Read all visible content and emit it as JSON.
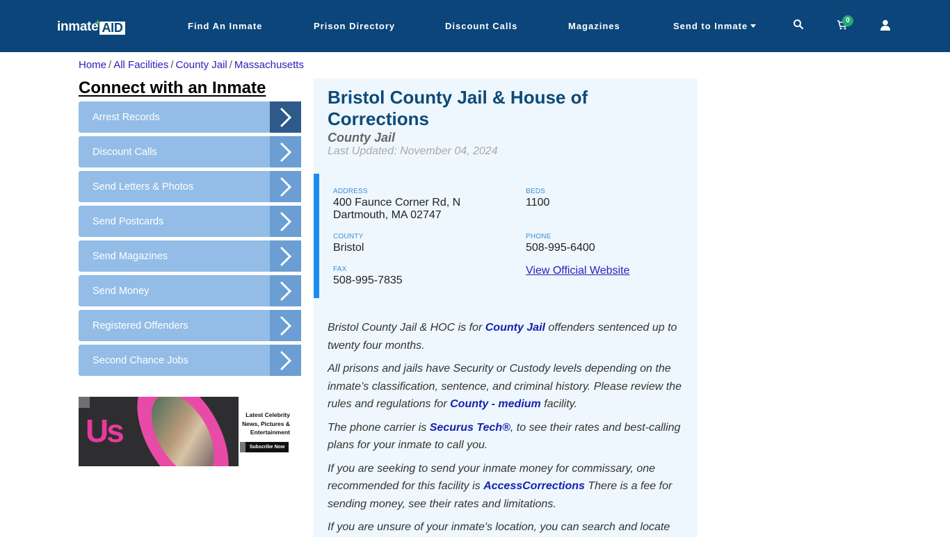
{
  "nav": {
    "logo_text": "inmate",
    "logo_aid": "AID",
    "items": [
      "Find An Inmate",
      "Prison Directory",
      "Discount Calls",
      "Magazines",
      "Send to Inmate"
    ],
    "cart_count": "0",
    "icons": [
      "search-icon",
      "cart-icon",
      "user-icon"
    ]
  },
  "breadcrumb": [
    "Home",
    "All Facilities",
    "County Jail",
    "Massachusetts"
  ],
  "sidebar": {
    "title": "Connect with an Inmate",
    "items": [
      "Arrest Records",
      "Discount Calls",
      "Send Letters & Photos",
      "Send Postcards",
      "Send Magazines",
      "Send Money",
      "Registered Offenders",
      "Second Chance Jobs"
    ],
    "ad": {
      "brand": "Us",
      "headline": "Latest Celebrity News, Pictures & Entertainment",
      "cta": "Subscribe Now"
    }
  },
  "facility": {
    "name": "Bristol County Jail & House of Corrections",
    "type": "County Jail",
    "last_updated": "Last Updated: November 04, 2024",
    "address_label": "ADDRESS",
    "address_line1": "400 Faunce Corner Rd, N",
    "address_line2": "Dartmouth, MA 02747",
    "beds_label": "BEDS",
    "beds": "1100",
    "county_label": "COUNTY",
    "county": "Bristol",
    "phone_label": "PHONE",
    "phone": "508-995-6400",
    "fax_label": "FAX",
    "fax": "508-995-7835",
    "website_link": "View Official Website"
  },
  "paragraphs": {
    "p1_a": "Bristol County Jail & HOC is for ",
    "p1_link": "County Jail",
    "p1_b": " offenders sentenced up to twenty four months.",
    "p2_a": "All prisons and jails have Security or Custody levels depending on the inmate’s classification, sentence, and criminal history. Please review the rules and regulations for ",
    "p2_link": "County - medium",
    "p2_b": " facility.",
    "p3_a": "The phone carrier is ",
    "p3_link": "Securus Tech®",
    "p3_b": ", to see their rates and best-calling plans for your inmate to call you.",
    "p4_a": "If you are seeking to send your inmate money for commissary, one recommended for this facility is ",
    "p4_link": "AccessCorrections",
    "p4_b": " There is a fee for sending money, see their rates and limitations.",
    "p5_a": "If you are unsure of your inmate's location, you can search and locate"
  }
}
